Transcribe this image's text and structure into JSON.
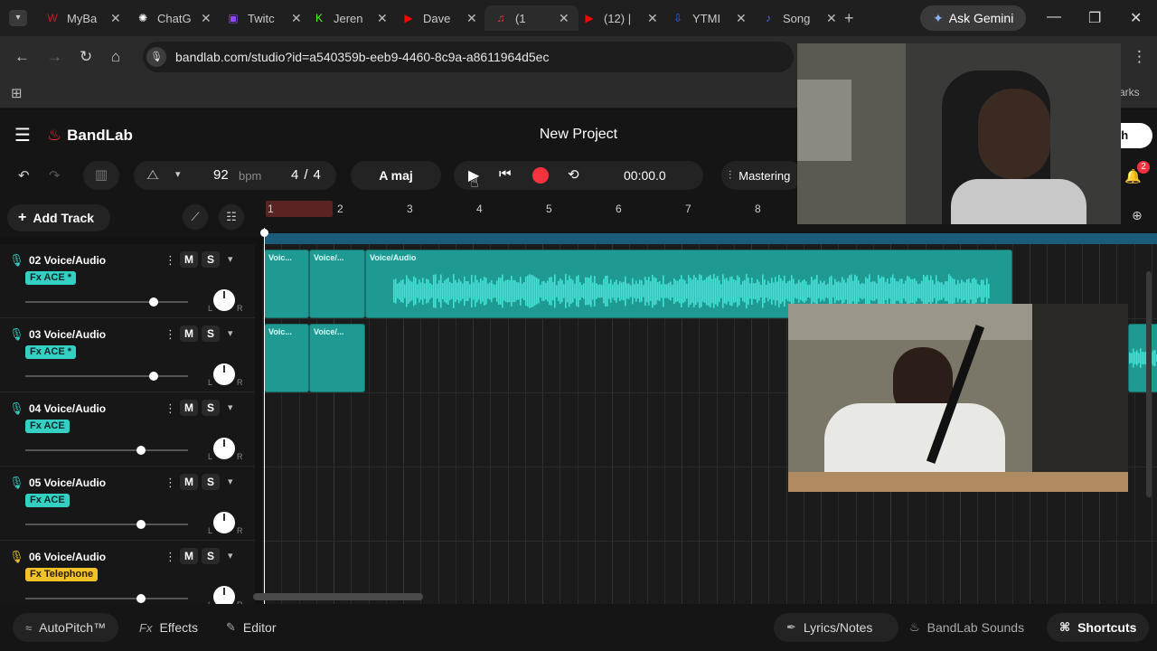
{
  "browser": {
    "tabs": [
      {
        "title": "MyBa",
        "color": "#c21f2a",
        "glyph": "W"
      },
      {
        "title": "ChatG",
        "color": "#ffffff",
        "glyph": "✺"
      },
      {
        "title": "Twitc",
        "color": "#9146ff",
        "glyph": "▣"
      },
      {
        "title": "Jeren",
        "color": "#53fc18",
        "glyph": "K"
      },
      {
        "title": "Dave",
        "color": "#ff0000",
        "glyph": "▶"
      },
      {
        "title": "(1",
        "color": "#f5333f",
        "glyph": "♫"
      },
      {
        "title": "(12) |",
        "color": "#ff0000",
        "glyph": "▶"
      },
      {
        "title": "YTMI",
        "color": "#1a73e8",
        "glyph": "⇩"
      },
      {
        "title": "Song",
        "color": "#4c6ef5",
        "glyph": "♪"
      }
    ],
    "ask_gemini": "Ask Gemini",
    "url": "bandlab.com/studio?id=a540359b-eeb9-4460-8c9a-a8611964d5ec",
    "bookmarks_fragment": "arks"
  },
  "app": {
    "brand": "BandLab",
    "project_title": "New Project",
    "publish_fragment": "sh",
    "notifications_count": "2"
  },
  "toolbar": {
    "bpm": "92",
    "bpm_unit": "bpm",
    "time_signature_top": "4",
    "time_signature_sep": "/",
    "time_signature_bottom": "4",
    "key": "A maj",
    "timecode": "00:00.0",
    "mastering": "Mastering"
  },
  "tracks_header": {
    "add_track": "Add Track"
  },
  "ruler": {
    "bars": [
      "1",
      "2",
      "3",
      "4",
      "5",
      "6",
      "7",
      "8"
    ]
  },
  "tracks": [
    {
      "name": "02 Voice/Audio",
      "fx": "Fx ACE *",
      "fx_color": "teal",
      "mute": "M",
      "solo": "S",
      "level": 0.79,
      "pan_l": "L",
      "pan_r": "R"
    },
    {
      "name": "03 Voice/Audio",
      "fx": "Fx ACE *",
      "fx_color": "teal",
      "mute": "M",
      "solo": "S",
      "level": 0.79,
      "pan_l": "L",
      "pan_r": "R"
    },
    {
      "name": "04 Voice/Audio",
      "fx": "Fx ACE",
      "fx_color": "teal",
      "mute": "M",
      "solo": "S",
      "level": 0.71,
      "pan_l": "L",
      "pan_r": "R"
    },
    {
      "name": "05 Voice/Audio",
      "fx": "Fx ACE",
      "fx_color": "teal",
      "mute": "M",
      "solo": "S",
      "level": 0.71,
      "pan_l": "L",
      "pan_r": "R"
    },
    {
      "name": "06 Voice/Audio",
      "fx": "Fx Telephone",
      "fx_color": "yellow",
      "mute": "M",
      "solo": "S",
      "level": 0.71,
      "pan_l": "L",
      "pan_r": "R"
    }
  ],
  "clips": {
    "t02": [
      "Voic...",
      "Voice/...",
      "Voice/Audio"
    ],
    "t03": [
      "Voic...",
      "Voice/..."
    ]
  },
  "bottom": {
    "autopitch": "AutoPitch™",
    "effects": "Effects",
    "effects_prefix": "Fx",
    "editor": "Editor",
    "lyrics": "Lyrics/Notes",
    "sounds": "BandLab Sounds",
    "shortcuts": "Shortcuts"
  },
  "colors": {
    "accent_red": "#f5333f",
    "clip_teal": "#1f9a92",
    "waveform": "#3fe3d6",
    "fx_yellow": "#f2c229"
  }
}
